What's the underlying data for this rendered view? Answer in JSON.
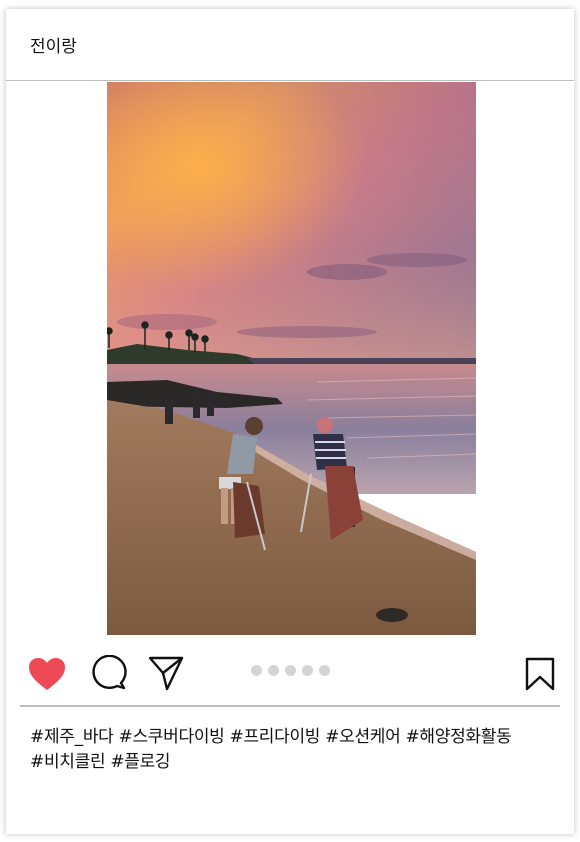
{
  "post": {
    "username": "전이랑",
    "photo": {
      "subject": "beach-cleanup-sunset-photo"
    },
    "actions": {
      "like_icon": "heart-filled-icon",
      "comment_icon": "comment-bubble-icon",
      "share_icon": "paper-plane-icon",
      "save_icon": "bookmark-icon",
      "like_color": "#ed4956",
      "carousel": {
        "count": 5
      }
    },
    "hashtags": [
      "#제주_바다",
      "#스쿠버다이빙",
      "#프리다이빙",
      "#오션케어",
      "#해양정화활동",
      "#비치클린",
      "#플로깅"
    ]
  }
}
